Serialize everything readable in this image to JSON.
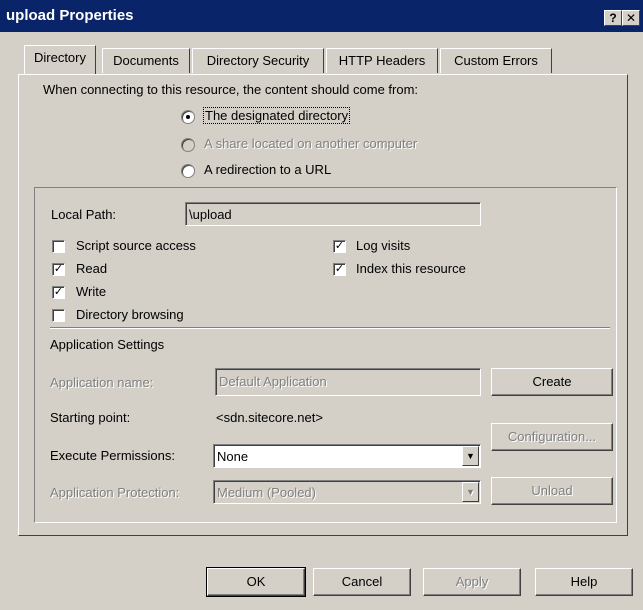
{
  "window": {
    "title": "upload Properties",
    "help_btn": "?",
    "close_btn": "✕"
  },
  "tabs": [
    {
      "label": "Directory",
      "active": true
    },
    {
      "label": "Documents",
      "active": false
    },
    {
      "label": "Directory Security",
      "active": false
    },
    {
      "label": "HTTP Headers",
      "active": false
    },
    {
      "label": "Custom Errors",
      "active": false
    }
  ],
  "content_source": {
    "prompt": "When connecting to this resource, the content should come from:",
    "options": [
      {
        "label": "The designated directory",
        "selected": true,
        "enabled": true
      },
      {
        "label": "A share located on another computer",
        "selected": false,
        "enabled": false
      },
      {
        "label": "A redirection to a URL",
        "selected": false,
        "enabled": true
      }
    ]
  },
  "local_path": {
    "label": "Local Path:",
    "value": "\\upload"
  },
  "checkboxes": {
    "script_source_access": {
      "label": "Script source access",
      "checked": false
    },
    "read": {
      "label": "Read",
      "checked": true
    },
    "write": {
      "label": "Write",
      "checked": true
    },
    "directory_browsing": {
      "label": "Directory browsing",
      "checked": false
    },
    "log_visits": {
      "label": "Log visits",
      "checked": true
    },
    "index_resource": {
      "label": "Index this resource",
      "checked": true
    }
  },
  "app_settings": {
    "heading": "Application Settings",
    "app_name_label": "Application name:",
    "app_name_value": "Default Application",
    "create_btn": "Create",
    "starting_point_label": "Starting point:",
    "starting_point_value": "<sdn.sitecore.net>",
    "configuration_btn": "Configuration...",
    "exec_perm_label": "Execute Permissions:",
    "exec_perm_value": "None",
    "app_protection_label": "Application Protection:",
    "app_protection_value": "Medium (Pooled)",
    "unload_btn": "Unload"
  },
  "footer": {
    "ok": "OK",
    "cancel": "Cancel",
    "apply": "Apply",
    "help": "Help"
  },
  "colors": {
    "titlebar": "#0a246a",
    "face": "#d4d0c8"
  }
}
